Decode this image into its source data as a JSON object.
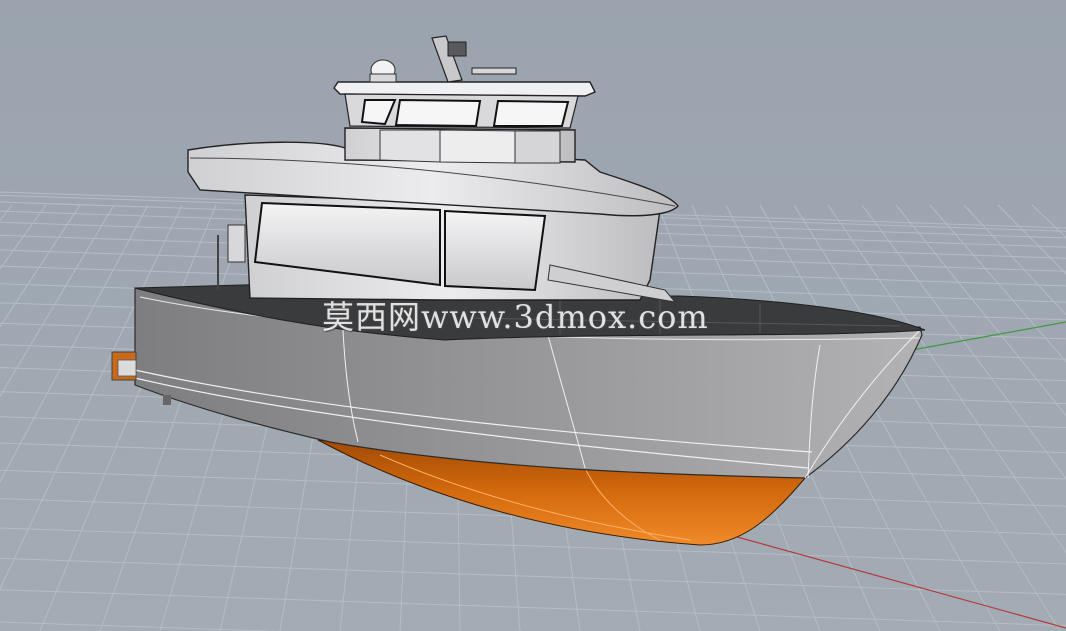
{
  "viewport": {
    "label": "Rhino 3D perspective viewport",
    "background_color": "#9ea7b1",
    "grid_color": "#b4bcc4",
    "x_axis_color": "#b43a3a",
    "y_axis_color": "#3f9a3f"
  },
  "model": {
    "type": "boat-hull-with-superstructure",
    "hull_color": "#8e8e8e",
    "bottom_color": "#d9680e",
    "cabin_color": "#e6e6e6",
    "deck_color": "#3a3b3d",
    "wire_color": "#f2f2f2"
  },
  "watermark": {
    "text": "莫西网www.3dmox.com"
  }
}
